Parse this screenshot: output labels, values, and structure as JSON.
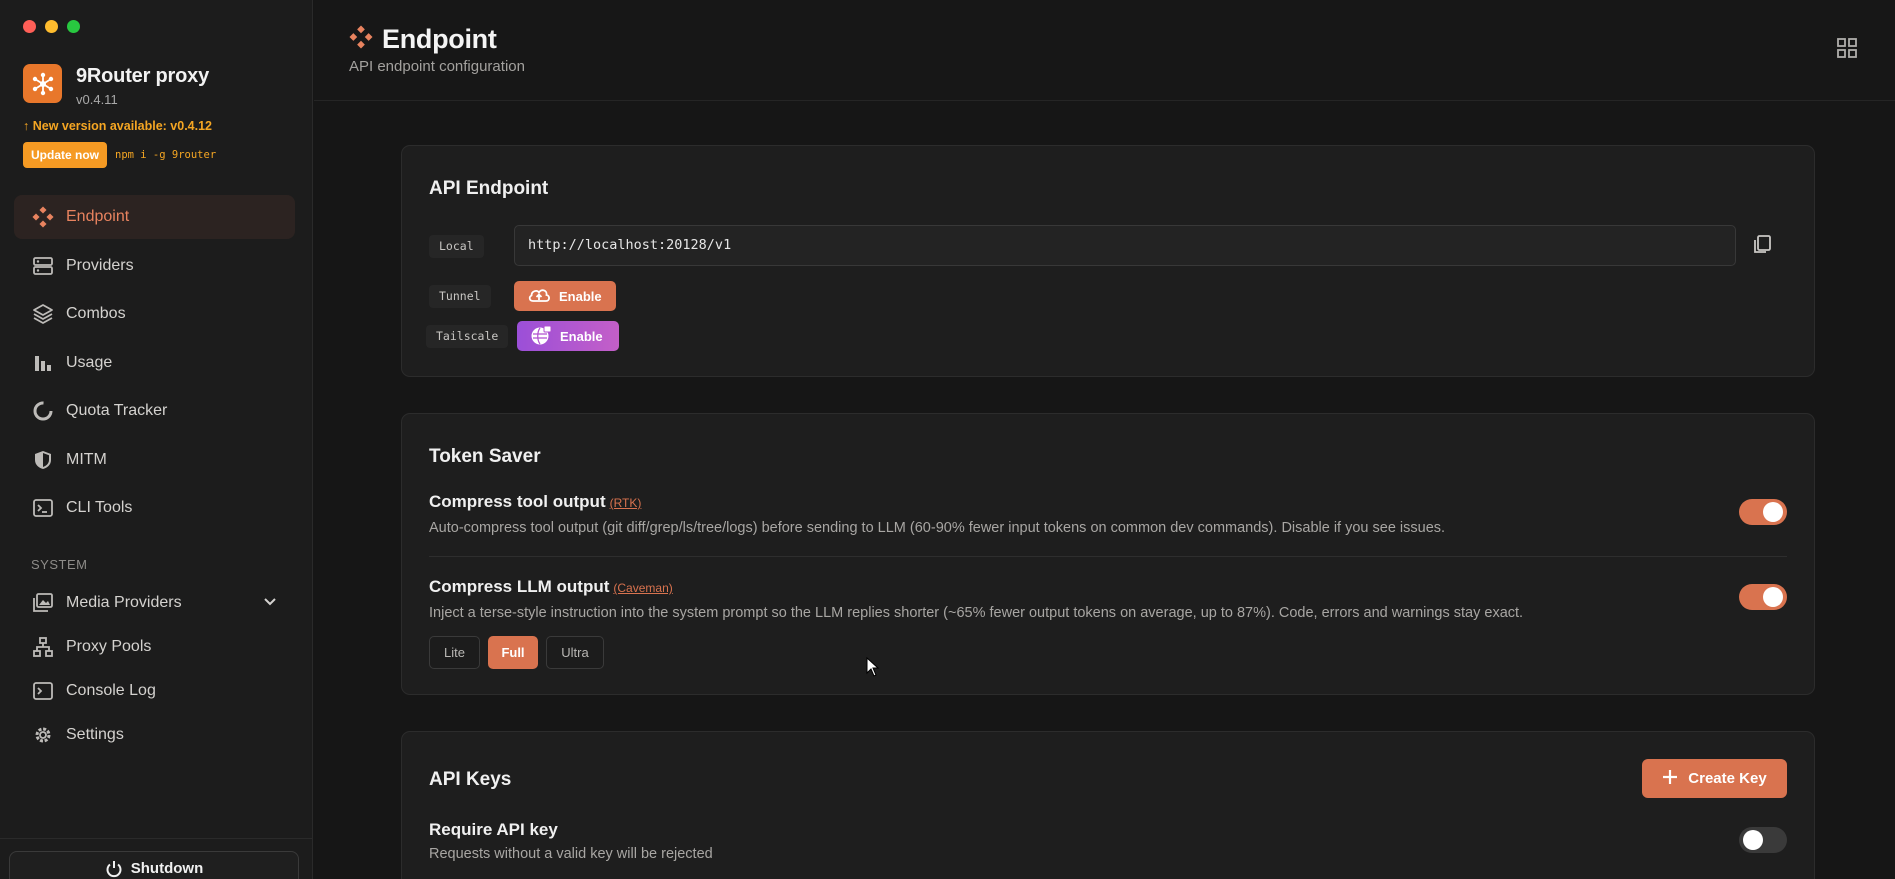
{
  "app": {
    "name": "9Router proxy",
    "version": "v0.4.11",
    "update_notice": "↑ New version available: v0.4.12",
    "update_button": "Update now",
    "update_command": "npm i -g 9router",
    "accent": "#d9734f"
  },
  "sidebar": {
    "items": [
      {
        "label": "Endpoint",
        "icon": "endpoint-icon",
        "active": true
      },
      {
        "label": "Providers",
        "icon": "server-icon"
      },
      {
        "label": "Combos",
        "icon": "layers-icon"
      },
      {
        "label": "Usage",
        "icon": "bar-chart-icon"
      },
      {
        "label": "Quota Tracker",
        "icon": "donut-icon"
      },
      {
        "label": "MITM",
        "icon": "shield-icon"
      },
      {
        "label": "CLI Tools",
        "icon": "terminal-icon"
      }
    ],
    "system_label": "SYSTEM",
    "system_items": [
      {
        "label": "Media Providers",
        "icon": "media-icon",
        "expandable": true
      },
      {
        "label": "Proxy Pools",
        "icon": "network-icon"
      },
      {
        "label": "Console Log",
        "icon": "console-icon"
      },
      {
        "label": "Settings",
        "icon": "gear-icon"
      }
    ],
    "shutdown_label": "Shutdown"
  },
  "header": {
    "title": "Endpoint",
    "subtitle": "API endpoint configuration"
  },
  "api_endpoint": {
    "title": "API Endpoint",
    "local_label": "Local",
    "local_url": "http://localhost:20128/v1",
    "tunnel_label": "Tunnel",
    "tunnel_button": "Enable",
    "tailscale_label": "Tailscale",
    "tailscale_button": "Enable"
  },
  "token_saver": {
    "title": "Token Saver",
    "compress_tool": {
      "title": "Compress tool output",
      "tag": "(RTK)",
      "desc": "Auto-compress tool output (git diff/grep/ls/tree/logs) before sending to LLM (60-90% fewer input tokens on common dev commands). Disable if you see issues.",
      "enabled": true
    },
    "compress_llm": {
      "title": "Compress LLM output",
      "tag": "(Caveman)",
      "desc": "Inject a terse-style instruction into the system prompt so the LLM replies shorter (~65% fewer output tokens on average, up to 87%). Code, errors and warnings stay exact.",
      "enabled": true,
      "modes": [
        "Lite",
        "Full",
        "Ultra"
      ],
      "selected_mode": "Full"
    }
  },
  "api_keys": {
    "title": "API Keys",
    "create_button": "Create Key",
    "require_title": "Require API key",
    "require_desc": "Requests without a valid key will be rejected",
    "require_enabled": false
  }
}
